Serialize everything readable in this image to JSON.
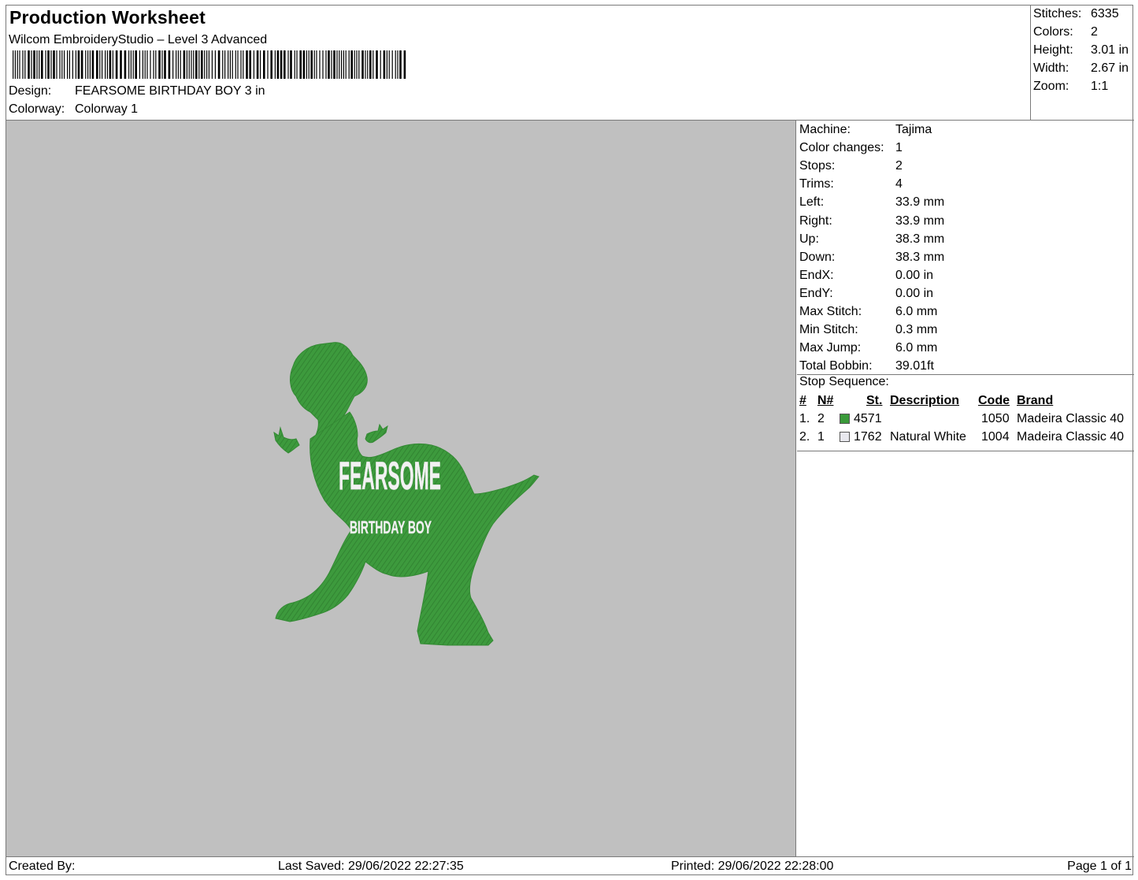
{
  "header": {
    "title": "Production Worksheet",
    "app_name": "Wilcom EmbroideryStudio – Level 3 Advanced",
    "design_label": "Design:",
    "design_value": "FEARSOME BIRTHDAY BOY 3 in",
    "colorway_label": "Colorway:",
    "colorway_value": "Colorway 1"
  },
  "summary": {
    "stitches_label": "Stitches:",
    "stitches_value": "6335",
    "colors_label": "Colors:",
    "colors_value": "2",
    "height_label": "Height:",
    "height_value": "3.01 in",
    "width_label": "Width:",
    "width_value": "2.67 in",
    "zoom_label": "Zoom:",
    "zoom_value": "1:1"
  },
  "design_preview": {
    "text_line1": "FEARSOME",
    "text_line2": "BIRTHDAY BOY",
    "background_color": "#c0c0c0",
    "thread_green": "#3d9a3d",
    "thread_white": "#f2f2f2"
  },
  "machine_info": [
    {
      "label": "Machine:",
      "value": "Tajima"
    },
    {
      "label": "Color changes:",
      "value": "1"
    },
    {
      "label": "Stops:",
      "value": "2"
    },
    {
      "label": "Trims:",
      "value": "4"
    },
    {
      "label": "Left:",
      "value": "33.9 mm"
    },
    {
      "label": "Right:",
      "value": "33.9 mm"
    },
    {
      "label": "Up:",
      "value": "38.3 mm"
    },
    {
      "label": "Down:",
      "value": "38.3 mm"
    },
    {
      "label": "EndX:",
      "value": "0.00 in"
    },
    {
      "label": "EndY:",
      "value": "0.00 in"
    },
    {
      "label": "Max Stitch:",
      "value": "6.0 mm"
    },
    {
      "label": "Min Stitch:",
      "value": "0.3 mm"
    },
    {
      "label": "Max Jump:",
      "value": "6.0 mm"
    },
    {
      "label": "Total Bobbin:",
      "value": "39.01ft"
    }
  ],
  "stop_sequence": {
    "title": "Stop Sequence:",
    "columns": {
      "num": "#",
      "n": "N#",
      "st": "St.",
      "description": "Description",
      "code": "Code",
      "brand": "Brand"
    },
    "rows": [
      {
        "num": "1.",
        "n": "2",
        "color": "#3a9a3a",
        "st": "4571",
        "description": "",
        "code": "1050",
        "brand": "Madeira Classic 40"
      },
      {
        "num": "2.",
        "n": "1",
        "color": "#e8e8ee",
        "st": "1762",
        "description": "Natural White",
        "code": "1004",
        "brand": "Madeira Classic 40"
      }
    ]
  },
  "footer": {
    "created_by": "Created By:",
    "last_saved": "Last Saved: 29/06/2022 22:27:35",
    "printed": "Printed: 29/06/2022 22:28:00",
    "page": "Page 1 of 1"
  }
}
